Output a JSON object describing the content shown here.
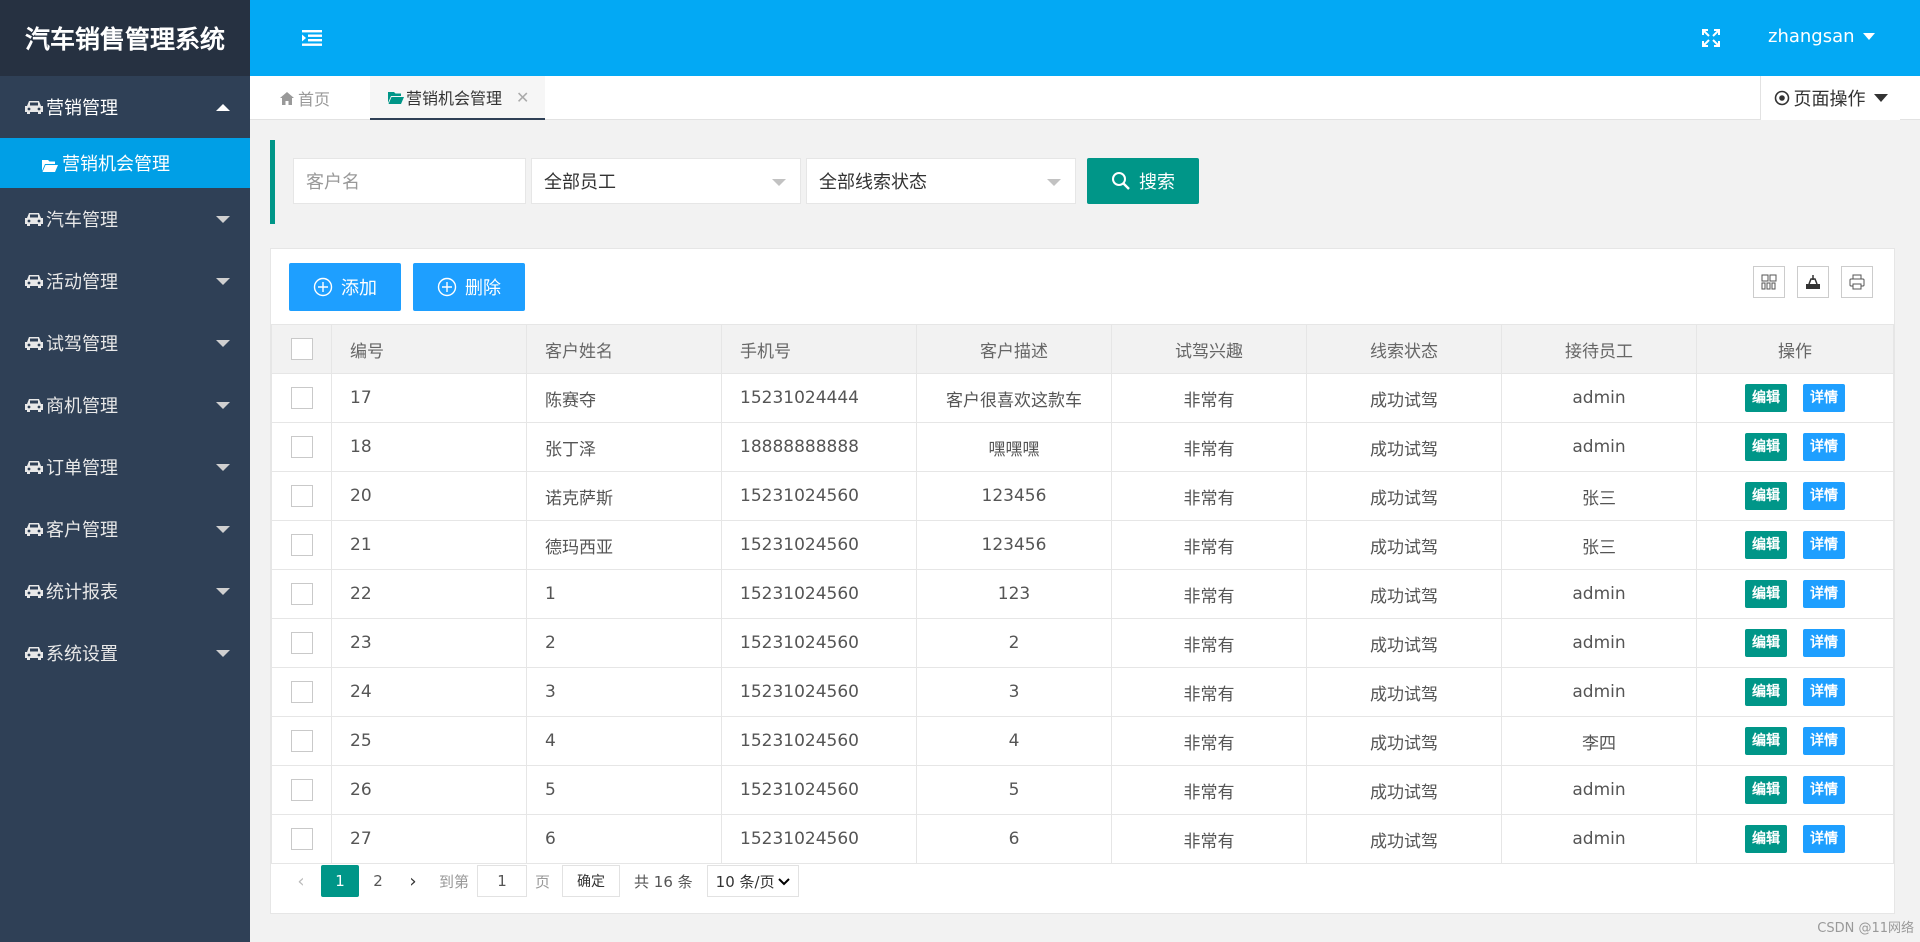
{
  "app": {
    "title": "汽车销售管理系统"
  },
  "header": {
    "user": "zhangsan"
  },
  "sidebar": {
    "items": [
      {
        "label": "营销管理",
        "open": true,
        "children": [
          {
            "label": "营销机会管理"
          }
        ]
      },
      {
        "label": "汽车管理"
      },
      {
        "label": "活动管理"
      },
      {
        "label": "试驾管理"
      },
      {
        "label": "商机管理"
      },
      {
        "label": "订单管理"
      },
      {
        "label": "客户管理"
      },
      {
        "label": "统计报表"
      },
      {
        "label": "系统设置"
      }
    ]
  },
  "tabs": {
    "home": "首页",
    "active": "营销机会管理",
    "page_ops": "页面操作"
  },
  "search": {
    "customer_placeholder": "客户名",
    "staff_select": "全部员工",
    "status_select": "全部线索状态",
    "search_label": "搜索"
  },
  "toolbar": {
    "add_label": "添加",
    "delete_label": "删除"
  },
  "table": {
    "columns": [
      "编号",
      "客户姓名",
      "手机号",
      "客户描述",
      "试驾兴趣",
      "线索状态",
      "接待员工",
      "操作"
    ],
    "edit_label": "编辑",
    "detail_label": "详情",
    "rows": [
      [
        "17",
        "陈赛夺",
        "15231024444",
        "客户很喜欢这款车",
        "非常有",
        "成功试驾",
        "admin"
      ],
      [
        "18",
        "张丁泽",
        "18888888888",
        "嘿嘿嘿",
        "非常有",
        "成功试驾",
        "admin"
      ],
      [
        "20",
        "诺克萨斯",
        "15231024560",
        "123456",
        "非常有",
        "成功试驾",
        "张三"
      ],
      [
        "21",
        "德玛西亚",
        "15231024560",
        "123456",
        "非常有",
        "成功试驾",
        "张三"
      ],
      [
        "22",
        "1",
        "15231024560",
        "123",
        "非常有",
        "成功试驾",
        "admin"
      ],
      [
        "23",
        "2",
        "15231024560",
        "2",
        "非常有",
        "成功试驾",
        "admin"
      ],
      [
        "24",
        "3",
        "15231024560",
        "3",
        "非常有",
        "成功试驾",
        "admin"
      ],
      [
        "25",
        "4",
        "15231024560",
        "4",
        "非常有",
        "成功试驾",
        "李四"
      ],
      [
        "26",
        "5",
        "15231024560",
        "5",
        "非常有",
        "成功试驾",
        "admin"
      ],
      [
        "27",
        "6",
        "15231024560",
        "6",
        "非常有",
        "成功试驾",
        "admin"
      ]
    ]
  },
  "pagination": {
    "pages": [
      "1",
      "2"
    ],
    "current": "1",
    "goto_label": "到第",
    "goto_value": "1",
    "page_label": "页",
    "confirm_label": "确定",
    "total_label": "共 16 条",
    "page_size": "10 条/页"
  },
  "watermark": "CSDN @11网络",
  "colors": {
    "header": "#03a9f4",
    "sidebar": "#2f4056",
    "teal": "#009688",
    "blue": "#1e9fff"
  }
}
